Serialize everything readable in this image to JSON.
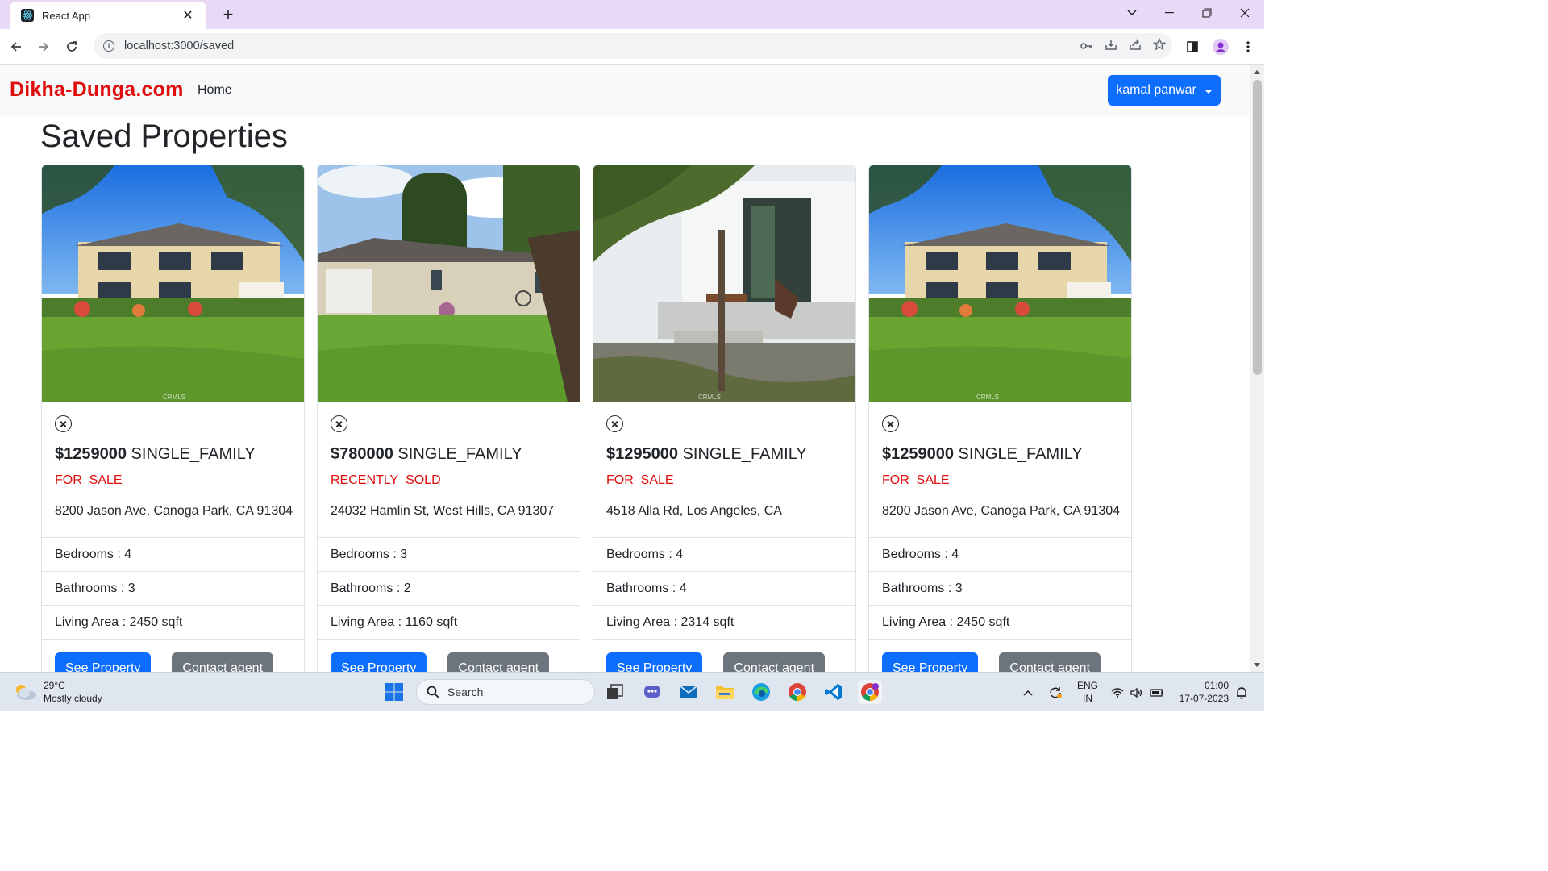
{
  "browser": {
    "tab_title": "React App",
    "url": "localhost:3000/saved"
  },
  "navbar": {
    "brand": "Dikha-Dunga.com",
    "home_link": "Home",
    "user_button": "kamal panwar"
  },
  "page": {
    "title": "Saved Properties"
  },
  "properties": [
    {
      "price": "$1259000",
      "home_type": " SINGLE_FAMILY",
      "status": "FOR_SALE",
      "address": "8200 Jason Ave, Canoga Park, CA 91304",
      "bedrooms": "Bedrooms : 4",
      "bathrooms": "Bathrooms : 3",
      "living_area": "Living Area : 2450 sqft",
      "see_button": "See Property",
      "contact_button": "Contact agent",
      "image_watermark": "CRMLS"
    },
    {
      "price": "$780000",
      "home_type": " SINGLE_FAMILY",
      "status": "RECENTLY_SOLD",
      "address": "24032 Hamlin St, West Hills, CA 91307",
      "bedrooms": "Bedrooms : 3",
      "bathrooms": "Bathrooms : 2",
      "living_area": "Living Area : 1160 sqft",
      "see_button": "See Property",
      "contact_button": "Contact agent",
      "image_watermark": ""
    },
    {
      "price": "$1295000",
      "home_type": " SINGLE_FAMILY",
      "status": "FOR_SALE",
      "address": "4518 Alla Rd, Los Angeles, CA",
      "bedrooms": "Bedrooms : 4",
      "bathrooms": "Bathrooms : 4",
      "living_area": "Living Area : 2314 sqft",
      "see_button": "See Property",
      "contact_button": "Contact agent",
      "image_watermark": "CRMLS"
    },
    {
      "price": "$1259000",
      "home_type": " SINGLE_FAMILY",
      "status": "FOR_SALE",
      "address": "8200 Jason Ave, Canoga Park, CA 91304",
      "bedrooms": "Bedrooms : 4",
      "bathrooms": "Bathrooms : 3",
      "living_area": "Living Area : 2450 sqft",
      "see_button": "See Property",
      "contact_button": "Contact agent",
      "image_watermark": "CRMLS"
    }
  ],
  "taskbar": {
    "weather_temp": "29°C",
    "weather_desc": "Mostly cloudy",
    "search_placeholder": "Search",
    "lang_top": "ENG",
    "lang_bottom": "IN",
    "time": "01:00",
    "date": "17-07-2023"
  },
  "colors": {
    "brand": "#e00d0d",
    "primary": "#0d6efd",
    "secondary": "#6c757d",
    "status": "#e00d0d"
  },
  "icons": [
    "react-favicon",
    "close-icon",
    "new-tab-icon",
    "back-icon",
    "forward-icon",
    "reload-icon",
    "site-info-icon",
    "key-icon",
    "install-icon",
    "share-icon",
    "star-icon",
    "sidepanel-icon",
    "profile-icon",
    "menu-icon",
    "remove-circle-icon"
  ]
}
